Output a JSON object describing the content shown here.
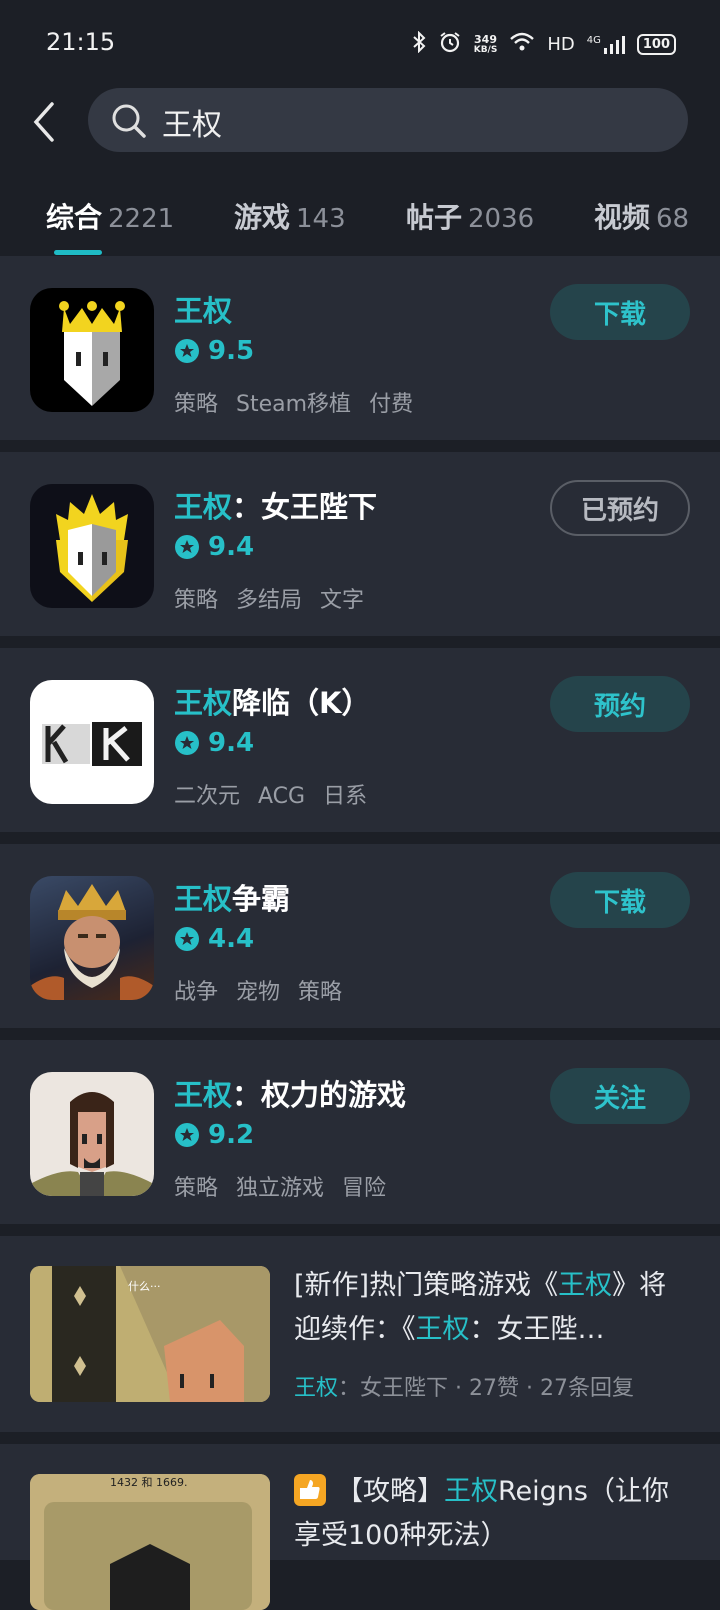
{
  "status": {
    "time": "21:15",
    "net_speed_value": "349",
    "net_speed_unit": "KB/S",
    "hd": "HD",
    "signal": "4G",
    "battery": "100"
  },
  "search": {
    "query": "王权"
  },
  "tabs": [
    {
      "label": "综合",
      "count": "2221"
    },
    {
      "label": "游戏",
      "count": "143"
    },
    {
      "label": "帖子",
      "count": "2036"
    },
    {
      "label": "视频",
      "count": "68"
    }
  ],
  "games": [
    {
      "title_hl": "王权",
      "title_rest": "",
      "rating": "9.5",
      "tags": [
        "策略",
        "Steam移植",
        "付费"
      ],
      "action": "下载"
    },
    {
      "title_hl": "王权",
      "title_rest": "：女王陛下",
      "rating": "9.4",
      "tags": [
        "策略",
        "多结局",
        "文字"
      ],
      "action": "已预约"
    },
    {
      "title_hl": "王权",
      "title_rest": "降临（K）",
      "rating": "9.4",
      "tags": [
        "二次元",
        "ACG",
        "日系"
      ],
      "action": "预约"
    },
    {
      "title_hl": "王权",
      "title_rest": "争霸",
      "rating": "4.4",
      "tags": [
        "战争",
        "宠物",
        "策略"
      ],
      "action": "下载"
    },
    {
      "title_hl": "王权",
      "title_rest": "：权力的游戏",
      "rating": "9.2",
      "tags": [
        "策略",
        "独立游戏",
        "冒险"
      ],
      "action": "关注"
    }
  ],
  "posts": [
    {
      "title_parts": [
        "[新作]热门策略游戏《",
        "王权",
        "》将迎续作：《",
        "王权",
        "：女王陛…"
      ],
      "meta_hl": "王权",
      "meta_rest": "：女王陛下 · 27赞 · 27条回复",
      "thumb_text": "什么···"
    },
    {
      "title_parts": [
        "【攻略】",
        "王权",
        "Reigns（让你享受100种死法）"
      ],
      "thumb_text": "1432 和 1669."
    }
  ],
  "colors": {
    "accent": "#27c0c8",
    "background": "#1c1f26",
    "card": "#282c36"
  }
}
